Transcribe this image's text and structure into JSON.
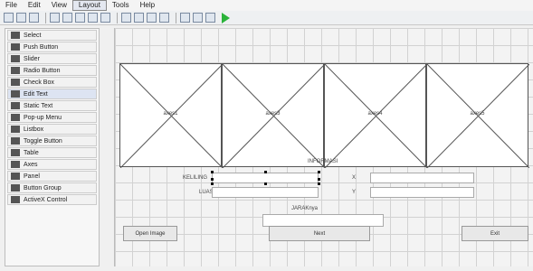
{
  "menu": [
    "File",
    "Edit",
    "View",
    "Layout",
    "Tools",
    "Help"
  ],
  "palette": [
    "Select",
    "Push Button",
    "Slider",
    "Radio Button",
    "Check Box",
    "Edit Text",
    "Static Text",
    "Pop-up Menu",
    "Listbox",
    "Toggle Button",
    "Table",
    "Axes",
    "Panel",
    "Button Group",
    "ActiveX Control"
  ],
  "axes_labels": [
    "axes1",
    "axes3",
    "axes4",
    "axes5"
  ],
  "static_text": {
    "informasi": "INFORMASI",
    "keliling": "KELILING",
    "luas": "LUAS",
    "x": "X",
    "y": "Y",
    "jaraknya": "JARAKnya"
  },
  "buttons": {
    "open": "Open Image",
    "next": "Next",
    "exit": "Exit"
  },
  "colors": {
    "run": "#2bb33a",
    "selected": "#dde4f2"
  },
  "chart_data": [
    {
      "type": "table",
      "title": "axes1"
    },
    {
      "type": "table",
      "title": "axes3"
    },
    {
      "type": "table",
      "title": "axes4"
    },
    {
      "type": "table",
      "title": "axes5"
    }
  ]
}
